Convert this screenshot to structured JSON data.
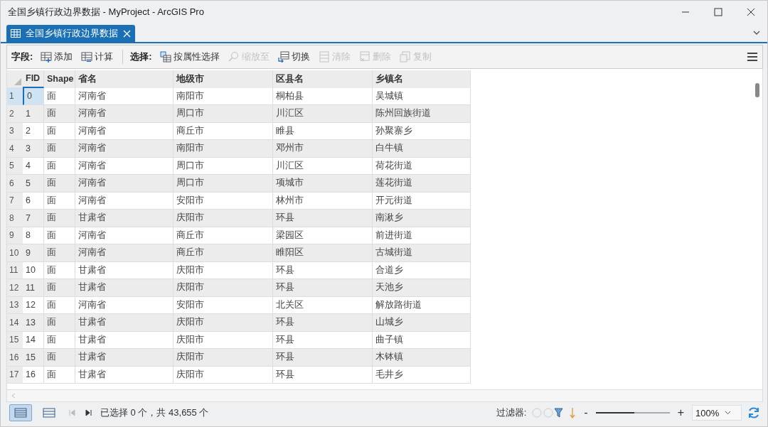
{
  "window": {
    "title": "全国乡镇行政边界数据 - MyProject - ArcGIS Pro"
  },
  "tabs": [
    {
      "label": "全国乡镇行政边界数据",
      "selected": true
    }
  ],
  "toolbar": {
    "field_label": "字段:",
    "field_tools": [
      {
        "label": "添加",
        "disabled": false
      },
      {
        "label": "计算",
        "disabled": false
      }
    ],
    "selection_label": "选择:",
    "selection_tools": [
      {
        "label": "按属性选择",
        "disabled": false
      },
      {
        "label": "缩放至",
        "disabled": true
      },
      {
        "label": "切换",
        "disabled": false
      },
      {
        "label": "清除",
        "disabled": true
      },
      {
        "label": "删除",
        "disabled": true
      },
      {
        "label": "复制",
        "disabled": true
      }
    ]
  },
  "table": {
    "columns": [
      "FID",
      "Shape",
      "省名",
      "地级市",
      "区县名",
      "乡镇名"
    ],
    "rows": [
      {
        "num": "1",
        "current": true,
        "cells": [
          "0",
          "面",
          "河南省",
          "南阳市",
          "桐柏县",
          "吴城镇"
        ]
      },
      {
        "num": "2",
        "current": false,
        "cells": [
          "1",
          "面",
          "河南省",
          "周口市",
          "川汇区",
          "陈州回族街道"
        ]
      },
      {
        "num": "3",
        "current": false,
        "cells": [
          "2",
          "面",
          "河南省",
          "商丘市",
          "睢县",
          "孙聚寨乡"
        ]
      },
      {
        "num": "4",
        "current": false,
        "cells": [
          "3",
          "面",
          "河南省",
          "南阳市",
          "邓州市",
          "白牛镇"
        ]
      },
      {
        "num": "5",
        "current": false,
        "cells": [
          "4",
          "面",
          "河南省",
          "周口市",
          "川汇区",
          "荷花街道"
        ]
      },
      {
        "num": "6",
        "current": false,
        "cells": [
          "5",
          "面",
          "河南省",
          "周口市",
          "项城市",
          "莲花街道"
        ]
      },
      {
        "num": "7",
        "current": false,
        "cells": [
          "6",
          "面",
          "河南省",
          "安阳市",
          "林州市",
          "开元街道"
        ]
      },
      {
        "num": "8",
        "current": false,
        "cells": [
          "7",
          "面",
          "甘肃省",
          "庆阳市",
          "环县",
          "南湫乡"
        ]
      },
      {
        "num": "9",
        "current": false,
        "cells": [
          "8",
          "面",
          "河南省",
          "商丘市",
          "梁园区",
          "前进街道"
        ]
      },
      {
        "num": "10",
        "current": false,
        "cells": [
          "9",
          "面",
          "河南省",
          "商丘市",
          "睢阳区",
          "古城街道"
        ]
      },
      {
        "num": "11",
        "current": false,
        "cells": [
          "10",
          "面",
          "甘肃省",
          "庆阳市",
          "环县",
          "合道乡"
        ]
      },
      {
        "num": "12",
        "current": false,
        "cells": [
          "11",
          "面",
          "甘肃省",
          "庆阳市",
          "环县",
          "天池乡"
        ]
      },
      {
        "num": "13",
        "current": false,
        "cells": [
          "12",
          "面",
          "河南省",
          "安阳市",
          "北关区",
          "解放路街道"
        ]
      },
      {
        "num": "14",
        "current": false,
        "cells": [
          "13",
          "面",
          "甘肃省",
          "庆阳市",
          "环县",
          "山城乡"
        ]
      },
      {
        "num": "15",
        "current": false,
        "cells": [
          "14",
          "面",
          "甘肃省",
          "庆阳市",
          "环县",
          "曲子镇"
        ]
      },
      {
        "num": "16",
        "current": false,
        "cells": [
          "15",
          "面",
          "甘肃省",
          "庆阳市",
          "环县",
          "木钵镇"
        ]
      },
      {
        "num": "17",
        "current": false,
        "cells": [
          "16",
          "面",
          "甘肃省",
          "庆阳市",
          "环县",
          "毛井乡"
        ]
      }
    ]
  },
  "status_bar": {
    "views": [
      {
        "selected": true
      },
      {
        "selected": false
      }
    ],
    "selection_text": "已选择 0 个，共 43,655 个",
    "filter_label": "过滤器:",
    "zoom": {
      "minus": "-",
      "plus": "+",
      "level": 0.5,
      "value": "100%"
    }
  }
}
